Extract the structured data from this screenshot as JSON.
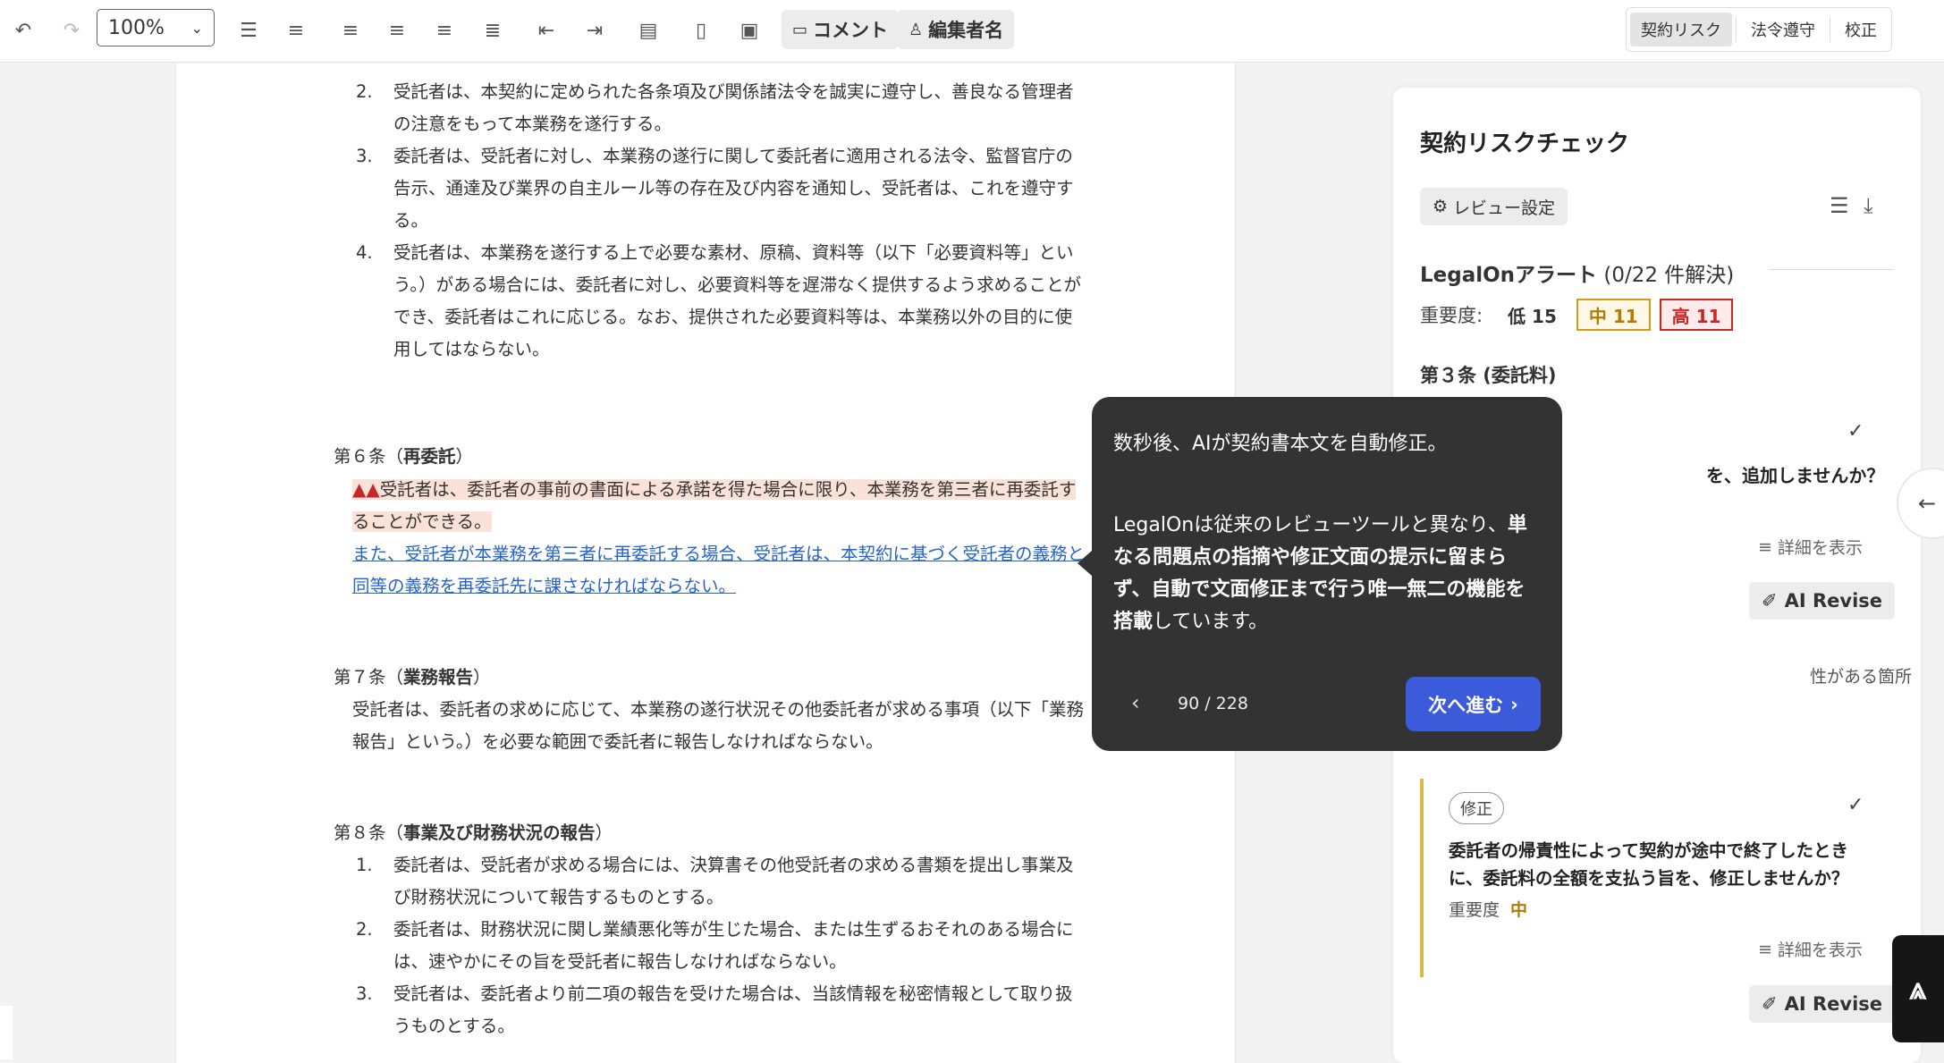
{
  "toolbar": {
    "zoom_value": "100%",
    "comment_label": "コメント",
    "editor_label": "編集者名",
    "modes": [
      "契約リスク",
      "法令遵守",
      "校正"
    ]
  },
  "doc": {
    "items_top": [
      {
        "num": "2.",
        "text": "受託者は、本契約に定められた各条項及び関係諸法令を誠実に遵守し、善良なる管理者の注意をもって本業務を遂行する。"
      },
      {
        "num": "3.",
        "text": "委託者は、受託者に対し、本業務の遂行に関して委託者に適用される法令、監督官庁の告示、通達及び業界の自主ルール等の存在及び内容を通知し、受託者は、これを遵守する。"
      },
      {
        "num": "4.",
        "text": "受託者は、本業務を遂行する上で必要な素材、原稿、資料等（以下「必要資料等」という。）がある場合には、委託者に対し、必要資料等を遅滞なく提供するよう求めることができ、委託者はこれに応じる。なお、提供された必要資料等は、本業務以外の目的に使用してはならない。"
      }
    ],
    "art6_prefix": "第６条（",
    "art6_title": "再委託",
    "art6_suffix": "）",
    "art6_warn": "▲▲",
    "art6_text": "受託者は、委託者の事前の書面による承諾を得た場合に限り、本業務を第三者に再委託することができる。",
    "art6_added": "また、受託者が本業務を第三者に再委託する場合、受託者は、本契約に基づく受託者の義務と同等の義務を再委託先に課さなければならない。",
    "art7_prefix": "第７条（",
    "art7_title": "業務報告",
    "art7_suffix": "）",
    "art7_text": "受託者は、委託者の求めに応じて、本業務の遂行状況その他委託者が求める事項（以下「業務報告」という。）を必要な範囲で委託者に報告しなければならない。",
    "art8_prefix": "第８条（",
    "art8_title": "事業及び財務状況の報告",
    "art8_suffix": "）",
    "items_art8": [
      {
        "num": "1.",
        "text": "委託者は、受託者が求める場合には、決算書その他受託者の求める書類を提出し事業及び財務状況について報告するものとする。"
      },
      {
        "num": "2.",
        "text": "委託者は、財務状況に関し業績悪化等が生じた場合、または生ずるおそれのある場合には、速やかにその旨を受託者に報告しなければならない。"
      },
      {
        "num": "3.",
        "text": "受託者は、委託者より前二項の報告を受けた場合は、当該情報を秘密情報として取り扱うものとする。"
      }
    ]
  },
  "panel": {
    "title": "契約リスクチェック",
    "review_settings": "レビュー設定",
    "alert_title": "LegalOnアラート",
    "alert_count": "(0/22 件解決)",
    "severity_label": "重要度:",
    "sev_low": "低 15",
    "sev_mid": "中 11",
    "sev_high": "高 11",
    "section": "第３条 (委託料)",
    "partial_question": "を、追加しませんか？",
    "detail": "詳細を表示",
    "ai_revise": "AI Revise",
    "partial_note": "性がある箇所",
    "card2_tag": "修正",
    "card2_question": "委託者の帰責性によって契約が途中で終了したときに、委託料の全額を支払う旨を、修正しませんか？",
    "card2_sev_label": "重要度",
    "card2_sev_value": "中"
  },
  "tooltip": {
    "line1": "数秒後、AIが契約書本文を自動修正。",
    "para_a": "LegalOnは従来のレビューツールと異なり、",
    "para_b": "単なる問題点の指摘や修正文面の提示に留まらず、自動で文面修正まで行う唯一無二の機能を搭載",
    "para_c": "しています。",
    "counter": "90 / 228",
    "next": "次へ進む"
  },
  "colors": {
    "accent": "#3b5bdb",
    "highlight": "#fbe2d8",
    "link": "#2563c9",
    "severity_mid": "#d39a1a",
    "severity_high": "#c62828"
  }
}
